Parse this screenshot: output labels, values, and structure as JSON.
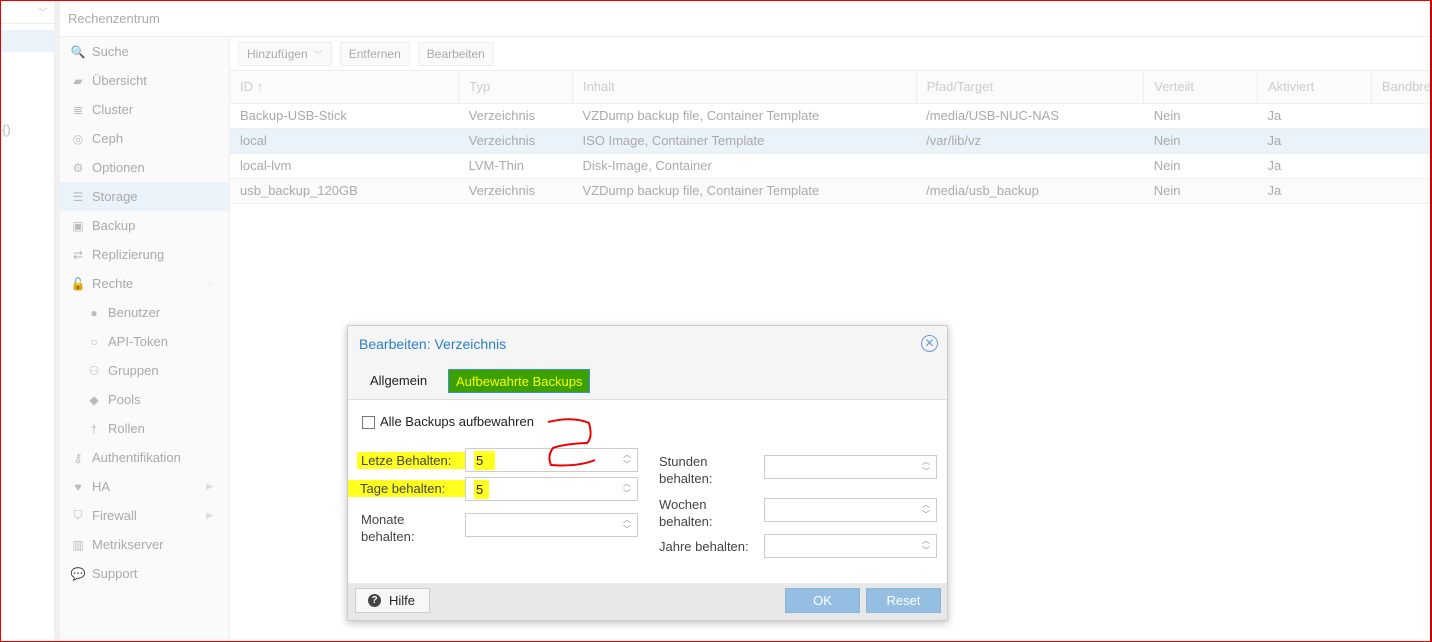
{
  "header": {
    "title": "Rechenzentrum"
  },
  "left": {
    "fragment": "{)"
  },
  "sidebar": {
    "items": [
      {
        "label": "Suche",
        "icon": "search-icon",
        "glyph": "🔍"
      },
      {
        "label": "Übersicht",
        "icon": "book-icon",
        "glyph": "▰"
      },
      {
        "label": "Cluster",
        "icon": "server-icon",
        "glyph": "≣"
      },
      {
        "label": "Ceph",
        "icon": "ceph-icon",
        "glyph": "◎"
      },
      {
        "label": "Optionen",
        "icon": "gear-icon",
        "glyph": "⚙"
      },
      {
        "label": "Storage",
        "icon": "database-icon",
        "glyph": "☰"
      },
      {
        "label": "Backup",
        "icon": "floppy-icon",
        "glyph": "▣"
      },
      {
        "label": "Replizierung",
        "icon": "retweet-icon",
        "glyph": "⇄"
      },
      {
        "label": "Rechte",
        "icon": "unlock-icon",
        "glyph": "🔓"
      },
      {
        "label": "Benutzer",
        "icon": "user-icon",
        "glyph": "●"
      },
      {
        "label": "API-Token",
        "icon": "user-outline-icon",
        "glyph": "○"
      },
      {
        "label": "Gruppen",
        "icon": "users-icon",
        "glyph": "⚇"
      },
      {
        "label": "Pools",
        "icon": "tags-icon",
        "glyph": "◆"
      },
      {
        "label": "Rollen",
        "icon": "male-icon",
        "glyph": "†"
      },
      {
        "label": "Authentifikation",
        "icon": "key-icon",
        "glyph": "⚷"
      },
      {
        "label": "HA",
        "icon": "heartbeat-icon",
        "glyph": "♥"
      },
      {
        "label": "Firewall",
        "icon": "shield-icon",
        "glyph": "⛉"
      },
      {
        "label": "Metrikserver",
        "icon": "bar-chart-icon",
        "glyph": "▥"
      },
      {
        "label": "Support",
        "icon": "comments-icon",
        "glyph": "💬"
      }
    ]
  },
  "toolbar": {
    "add": "Hinzufügen",
    "remove": "Entfernen",
    "edit": "Bearbeiten"
  },
  "table": {
    "columns": [
      "ID ↑",
      "Typ",
      "Inhalt",
      "Pfad/Target",
      "Verteilt",
      "Aktiviert",
      "Bandbre"
    ],
    "rows": [
      [
        "Backup-USB-Stick",
        "Verzeichnis",
        "VZDump backup file, Container Template",
        "/media/USB-NUC-NAS",
        "Nein",
        "Ja"
      ],
      [
        "local",
        "Verzeichnis",
        "ISO Image, Container Template",
        "/var/lib/vz",
        "Nein",
        "Ja"
      ],
      [
        "local-lvm",
        "LVM-Thin",
        "Disk-Image, Container",
        "",
        "Nein",
        "Ja"
      ],
      [
        "usb_backup_120GB",
        "Verzeichnis",
        "VZDump backup file, Container Template",
        "/media/usb_backup",
        "Nein",
        "Ja"
      ]
    ]
  },
  "dialog": {
    "title": "Bearbeiten: Verzeichnis",
    "tabs": [
      "Allgemein",
      "Aufbewahrte Backups"
    ],
    "keep_all": {
      "label": "Alle Backups aufbewahren",
      "checked": false
    },
    "fields": {
      "last": {
        "label": "Letze Behalten:",
        "value": "5"
      },
      "days": {
        "label": "Tage behalten:",
        "value": "5"
      },
      "months": {
        "label1": "Monate",
        "label2": "behalten:",
        "value": ""
      },
      "hours": {
        "label1": "Stunden",
        "label2": "behalten:",
        "value": ""
      },
      "weeks": {
        "label1": "Wochen",
        "label2": "behalten:",
        "value": ""
      },
      "years": {
        "label": "Jahre behalten:",
        "value": ""
      }
    },
    "help": "Hilfe",
    "ok": "OK",
    "reset": "Reset"
  }
}
